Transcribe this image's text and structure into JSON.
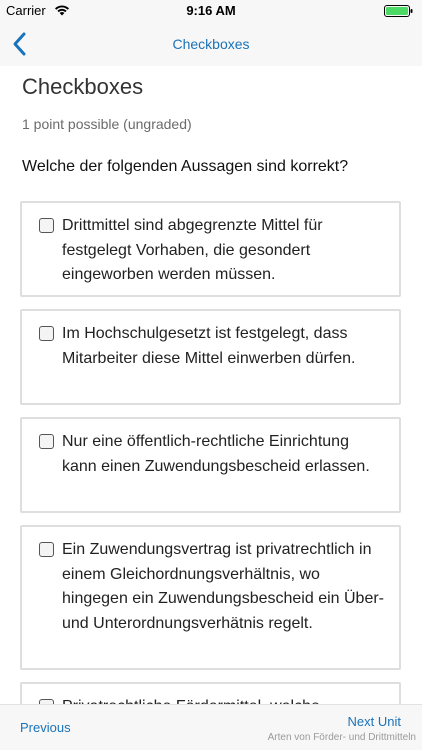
{
  "status_bar": {
    "carrier": "Carrier",
    "time": "9:16 AM"
  },
  "nav": {
    "title": "Checkboxes",
    "back_icon": "chevron-left-icon",
    "accent_color": "#1a73b8"
  },
  "problem": {
    "title": "Checkboxes",
    "points": "1 point possible (ungraded)",
    "question": "Welche der folgenden Aussagen sind korrekt?",
    "options": [
      {
        "text": "Drittmittel sind abgegrenzte Mittel für festgelegt Vorhaben, die gesondert eingeworben werden müssen.",
        "checked": false
      },
      {
        "text": "Im Hochschulgesetzt ist festgelegt, dass Mitarbeiter diese Mittel einwerben dürfen.",
        "checked": false
      },
      {
        "text": "Nur eine öffentlich-rechtliche Einrichtung kann einen Zuwendungsbescheid erlassen.",
        "checked": false
      },
      {
        "text": "Ein Zuwendungsvertrag ist privatrechtlich in einem Gleichordnungsverhältnis, wo hingegen ein Zuwendungsbescheid ein Über- und Unterordnungsverhätnis regelt.",
        "checked": false
      },
      {
        "text": "Privatrechtliche Fördermittel, welche",
        "checked": false
      }
    ]
  },
  "bottom_nav": {
    "previous_label": "Previous",
    "next_label": "Next Unit",
    "next_subtitle": "Arten von Förder- und Drittmitteln"
  }
}
